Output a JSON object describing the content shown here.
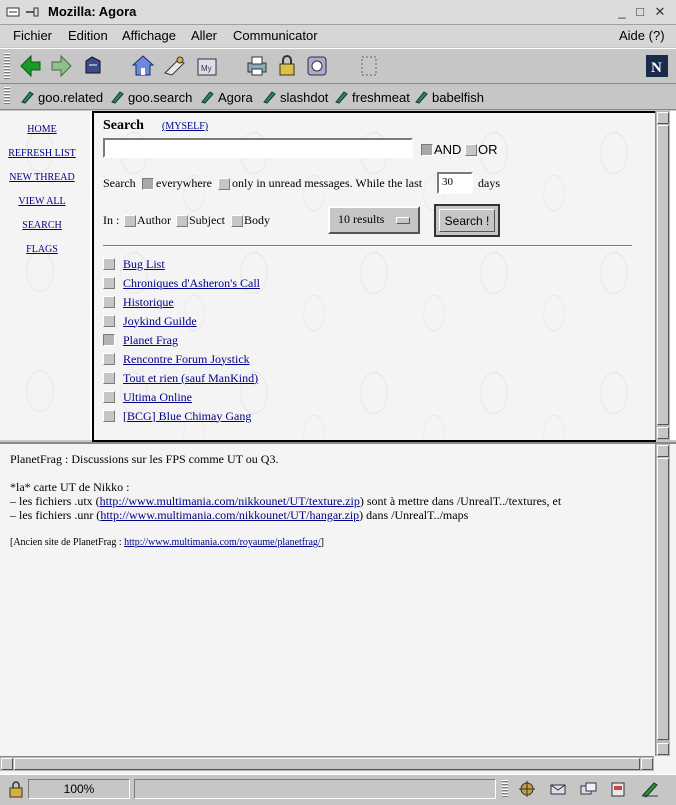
{
  "window": {
    "title": "Mozilla: Agora"
  },
  "menu": {
    "items": [
      "Fichier",
      "Edition",
      "Affichage",
      "Aller",
      "Communicator"
    ],
    "help": "Aide (?)"
  },
  "toolbar": {
    "icons": [
      "back-icon",
      "forward-icon",
      "reload-icon",
      "home-icon",
      "search-icon",
      "my-netscape-icon",
      "print-icon",
      "security-icon",
      "shop-icon",
      "stop-icon"
    ]
  },
  "bookmarks": [
    "goo.related",
    "goo.search",
    "Agora",
    "slashdot",
    "freshmeat",
    "babelfish"
  ],
  "nav": [
    "HOME",
    "REFRESH LIST",
    "NEW THREAD",
    "VIEW ALL",
    "SEARCH",
    "FLAGS"
  ],
  "search": {
    "title": "Search",
    "myself": "(MYSELF)",
    "query_value": "",
    "and_label": "AND",
    "or_label": "OR",
    "search_prefix": "Search",
    "everywhere_label": "everywhere",
    "unread_label": "only in unread messages. While the last",
    "days_value": "30",
    "days_label": "days",
    "in_label": "In :",
    "author_label": "Author",
    "subject_label": "Subject",
    "body_label": "Body",
    "results_value": "10 results",
    "search_button": "Search !"
  },
  "forums": [
    "Bug List",
    "Chroniques d'Asheron's Call",
    "Historique",
    "Joykind Guilde",
    "Planet Frag",
    "Rencontre Forum Joystick",
    "Tout et rien (sauf ManKind)",
    "Ultima Online",
    "[BCG] Blue Chimay Gang"
  ],
  "message": {
    "line1": "PlanetFrag : Discussions sur les FPS comme UT ou Q3.",
    "line2": "*la* carte UT de Nikko :",
    "line3_pre": "– les fichiers .utx (",
    "line3_link": "http://www.multimania.com/nikkounet/UT/texture.zip",
    "line3_post": ") sont à mettre dans /UnrealT../textures, et",
    "line4_pre": "– les fichiers .unr (",
    "line4_link": "http://www.multimania.com/nikkounet/UT/hangar.zip",
    "line4_post": ") dans /UnrealT../maps",
    "line5_pre": "[Ancien site de PlanetFrag : ",
    "line5_link": "http://www.multimania.com/royaume/planetfrag/",
    "line5_post": "]"
  },
  "status": {
    "zoom": "100%"
  }
}
